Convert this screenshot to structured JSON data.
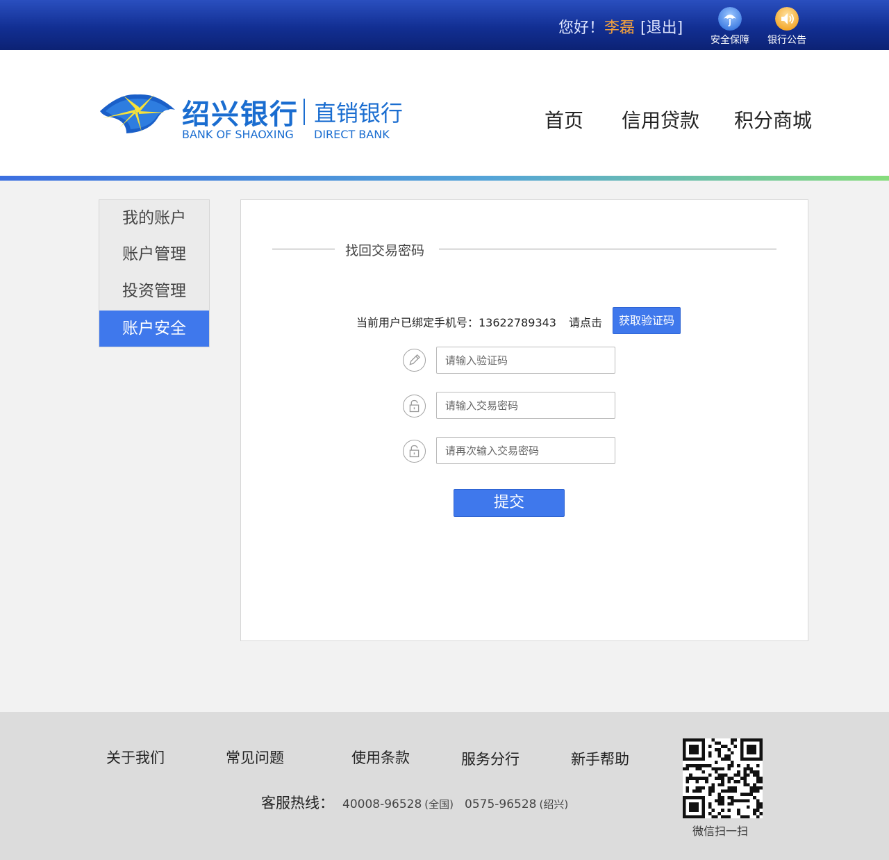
{
  "topbar": {
    "greeting": "您好！",
    "username": "李磊",
    "logout": "[退出]",
    "security": {
      "label": "安全保障",
      "icon": "umbrella-icon"
    },
    "notice": {
      "label": "银行公告",
      "icon": "speaker-icon"
    }
  },
  "brand": {
    "name_cn": "绍兴银行",
    "name_en": "BANK OF SHAOXING",
    "sub_cn": "直销银行",
    "sub_en": "DIRECT BANK"
  },
  "nav": {
    "home": "首页",
    "loan": "信用贷款",
    "mall": "积分商城"
  },
  "sidebar": {
    "items": [
      {
        "label": "我的账户"
      },
      {
        "label": "账户管理"
      },
      {
        "label": "投资管理"
      },
      {
        "label": "账户安全"
      }
    ],
    "active": "账户安全"
  },
  "form": {
    "title": "找回交易密码",
    "phone_label": "当前用户已绑定手机号：13622789343",
    "click_hint": "请点击",
    "get_code": "获取验证码",
    "code_placeholder": "请输入验证码",
    "password_placeholder": "请输入交易密码",
    "confirm_placeholder": "请再次输入交易密码",
    "submit": "提交"
  },
  "footer": {
    "links": [
      "关于我们",
      "常见问题",
      "使用条款",
      "服务分行",
      "新手帮助"
    ],
    "hotline_label": "客服热线：",
    "hotline_national": "40008-96528",
    "hotline_national_region": "(全国)",
    "hotline_local": "0575-96528",
    "hotline_local_region": "(绍兴)",
    "qr_label": "微信扫一扫"
  },
  "colors": {
    "topbar": "#122f93",
    "accent": "#3f78ec",
    "brand": "#1a6dd0",
    "username": "#f6a23b"
  }
}
